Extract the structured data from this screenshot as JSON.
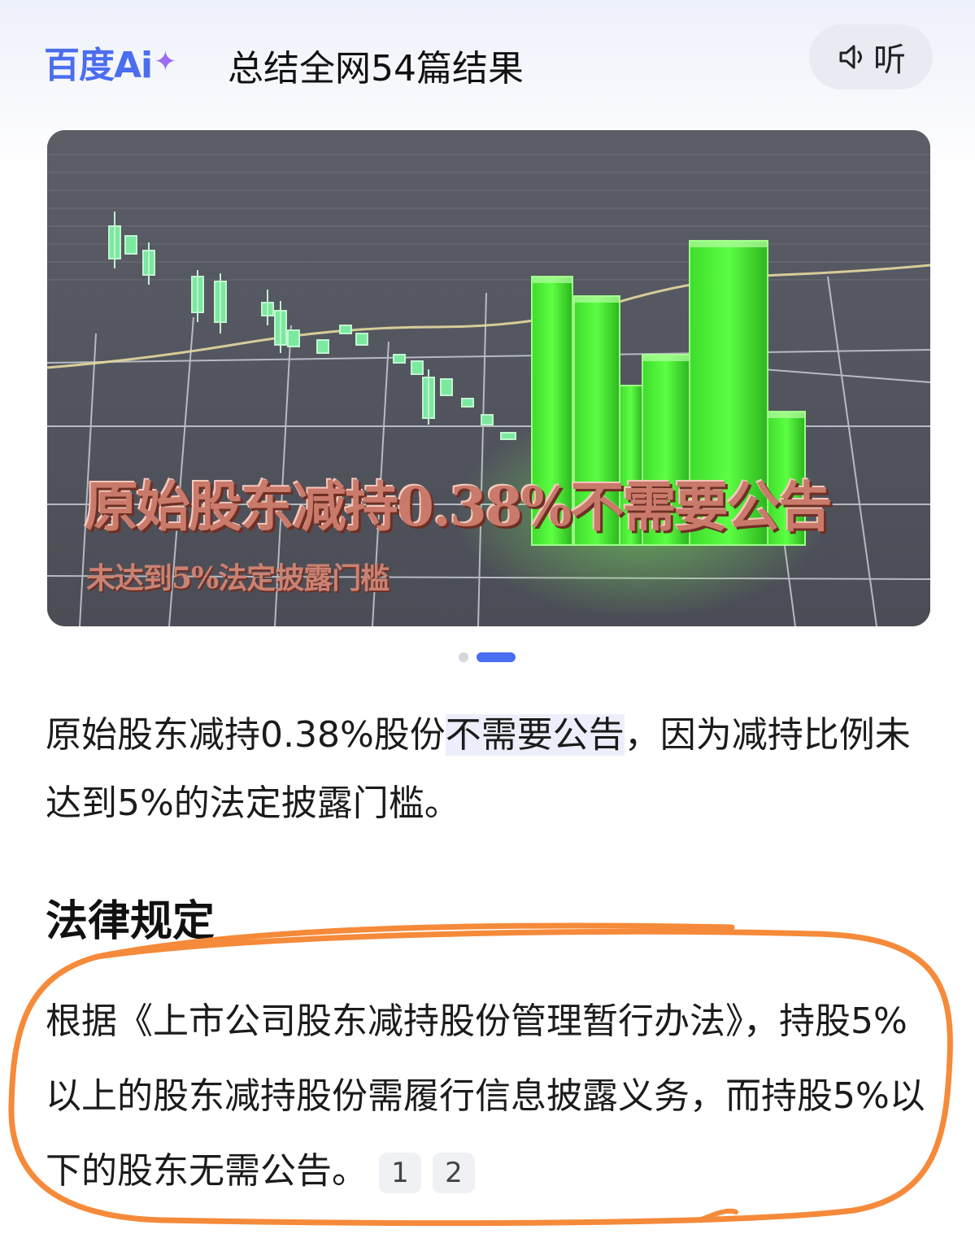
{
  "header": {
    "logo_text": "百度Ai",
    "title": "总结全网54篇结果",
    "listen_label": "听"
  },
  "image": {
    "overlay_title": "原始股东减持0.38%不需要公告",
    "overlay_subtitle": "未达到5%法定披露门槛",
    "carousel_count": 2,
    "carousel_active": 2
  },
  "summary": {
    "before": "原始股东减持0.38%股份",
    "highlight": "不需要公告",
    "after": "，因为减持比例未达到5%的法定披露门槛。"
  },
  "section": {
    "title": "法律规定",
    "body": "根据《上市公司股东减持股份管理暂行办法》，持股5%以上的股东减持股份需履行信息披露义务，而持股5%以下的股东无需公告。",
    "citations": [
      "1",
      "2"
    ]
  },
  "colors": {
    "brand_blue": "#4b6df0",
    "annotation_orange": "#f58a3a",
    "bar_green": "#4cf03a"
  }
}
